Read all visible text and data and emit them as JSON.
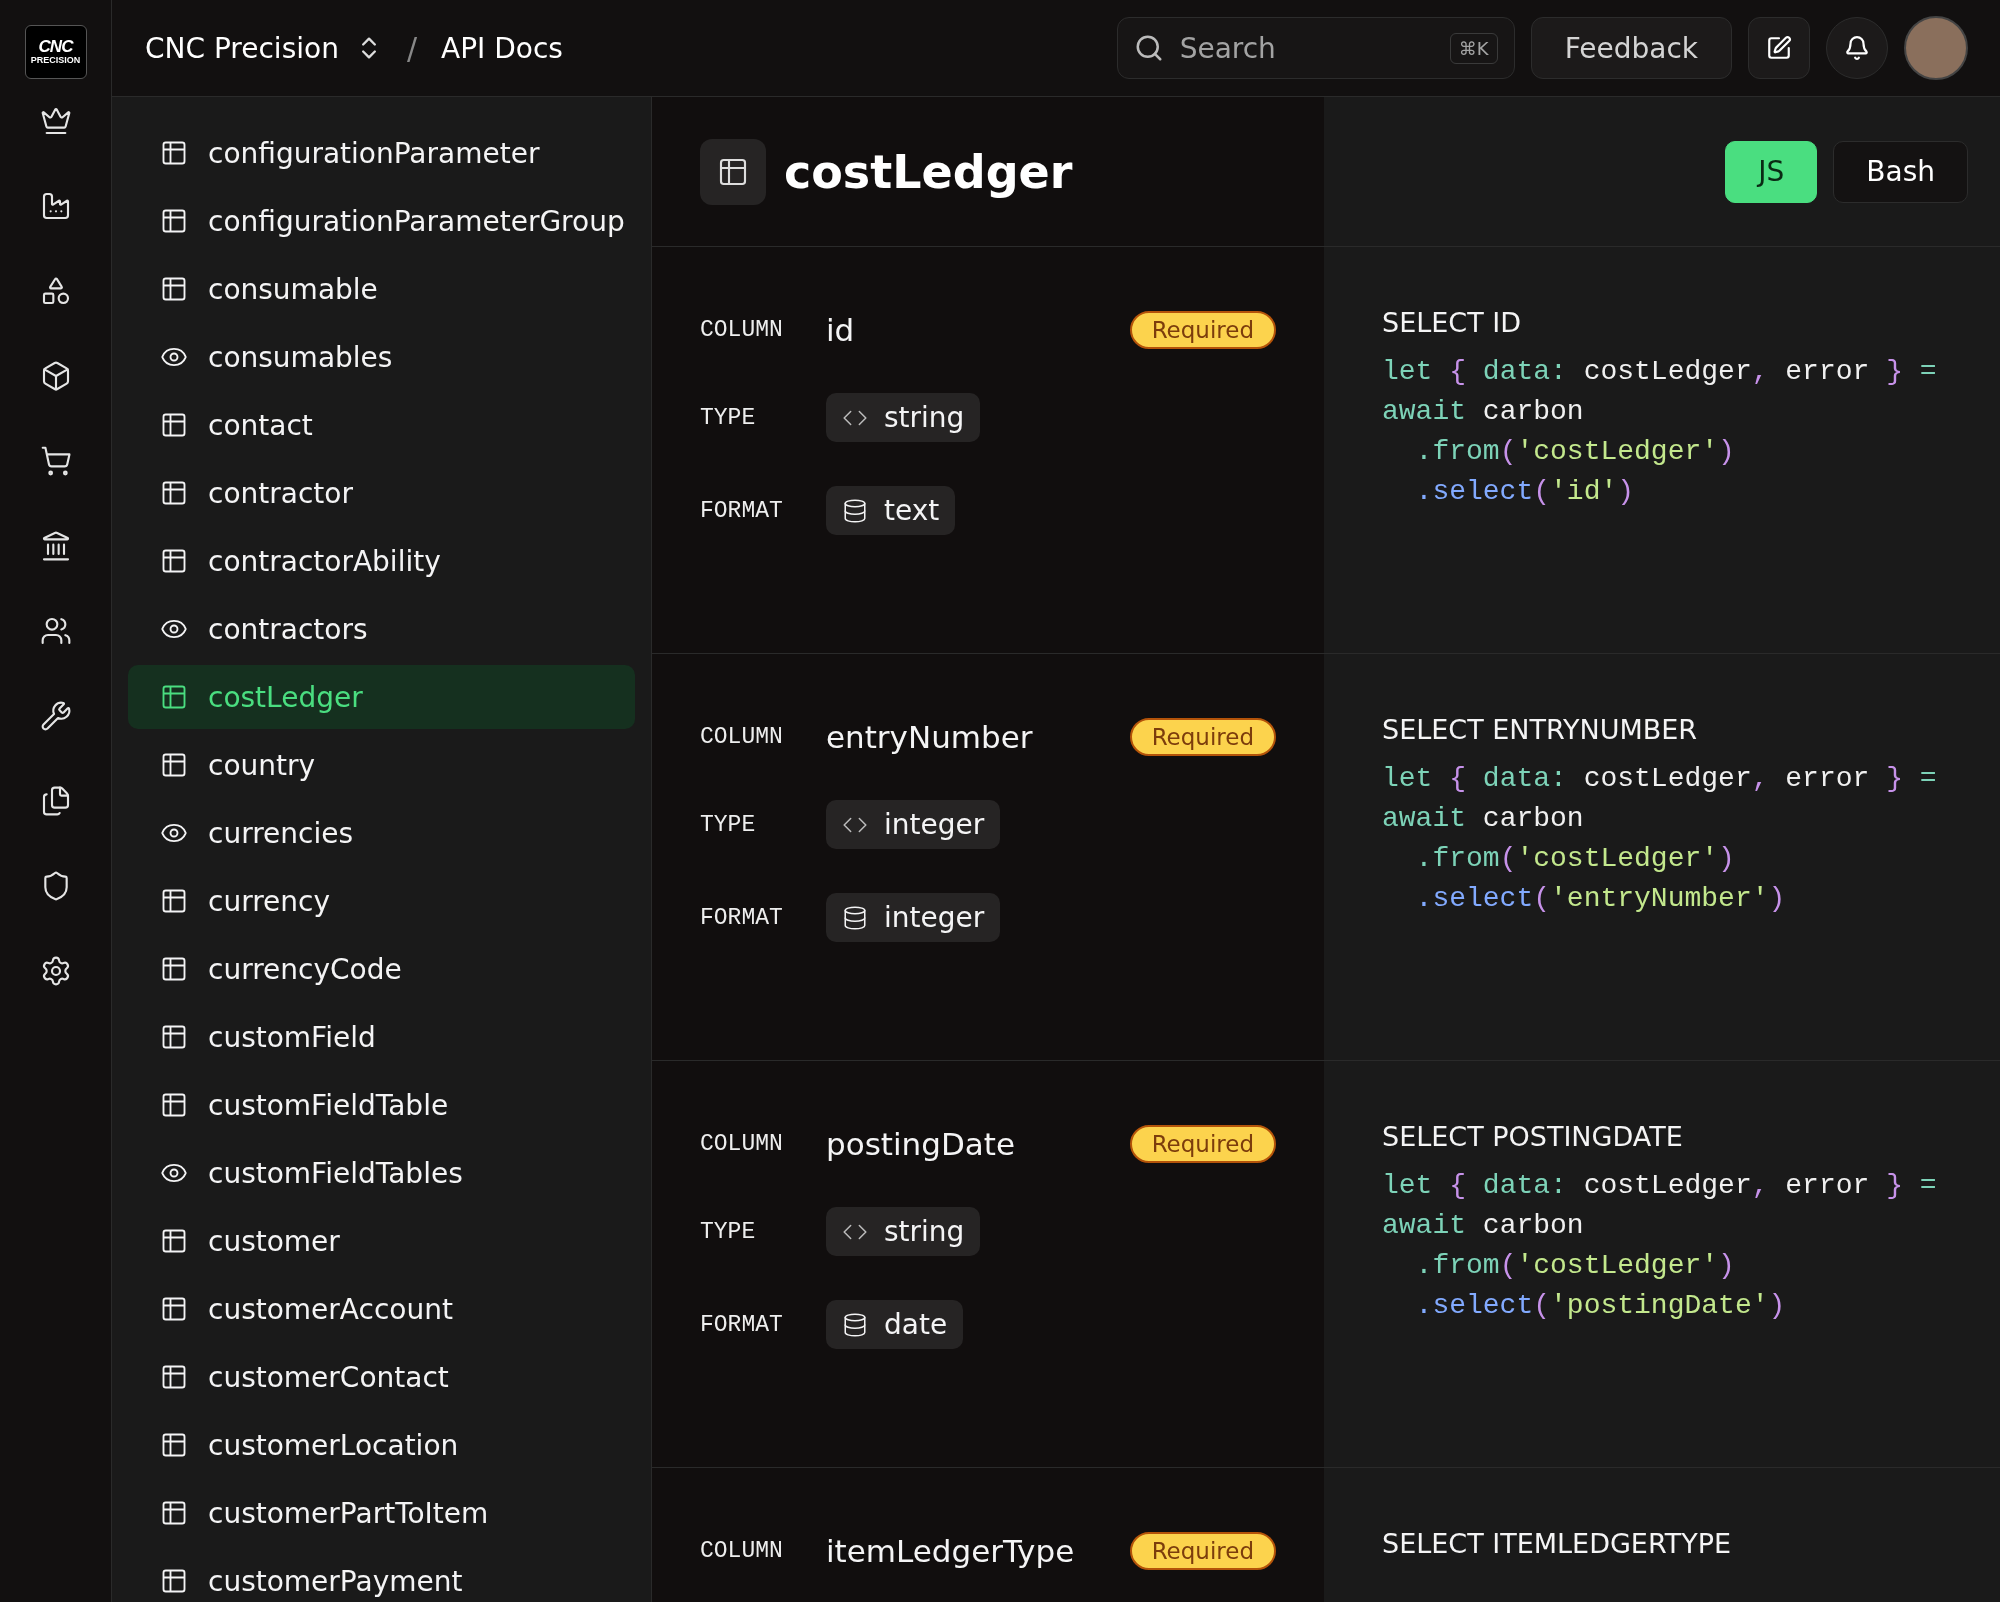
{
  "logo": {
    "line_1": "CNC",
    "line_2": "PRECISION"
  },
  "breadcrumb": {
    "workspace": "CNC Precision",
    "separator": "/",
    "page": "API Docs"
  },
  "search": {
    "placeholder": "Search",
    "shortcut": "⌘K"
  },
  "feedback_button": "Feedback",
  "sidebar": {
    "items": [
      {
        "label": "configurationParameter",
        "kind": "table",
        "selected": false
      },
      {
        "label": "configurationParameterGroup",
        "kind": "table",
        "selected": false
      },
      {
        "label": "consumable",
        "kind": "table",
        "selected": false
      },
      {
        "label": "consumables",
        "kind": "view",
        "selected": false
      },
      {
        "label": "contact",
        "kind": "table",
        "selected": false
      },
      {
        "label": "contractor",
        "kind": "table",
        "selected": false
      },
      {
        "label": "contractorAbility",
        "kind": "table",
        "selected": false
      },
      {
        "label": "contractors",
        "kind": "view",
        "selected": false
      },
      {
        "label": "costLedger",
        "kind": "table",
        "selected": true
      },
      {
        "label": "country",
        "kind": "table",
        "selected": false
      },
      {
        "label": "currencies",
        "kind": "view",
        "selected": false
      },
      {
        "label": "currency",
        "kind": "table",
        "selected": false
      },
      {
        "label": "currencyCode",
        "kind": "table",
        "selected": false
      },
      {
        "label": "customField",
        "kind": "table",
        "selected": false
      },
      {
        "label": "customFieldTable",
        "kind": "table",
        "selected": false
      },
      {
        "label": "customFieldTables",
        "kind": "view",
        "selected": false
      },
      {
        "label": "customer",
        "kind": "table",
        "selected": false
      },
      {
        "label": "customerAccount",
        "kind": "table",
        "selected": false
      },
      {
        "label": "customerContact",
        "kind": "table",
        "selected": false
      },
      {
        "label": "customerLocation",
        "kind": "table",
        "selected": false
      },
      {
        "label": "customerPartToItem",
        "kind": "table",
        "selected": false
      },
      {
        "label": "customerPayment",
        "kind": "table",
        "selected": false
      }
    ]
  },
  "title": "costLedger",
  "languages": [
    {
      "label": "JS",
      "selected": true
    },
    {
      "label": "Bash",
      "selected": false
    }
  ],
  "fields": [
    {
      "column_label": "COLUMN",
      "name": "id",
      "badge": "Required",
      "type_label": "TYPE",
      "type": "string",
      "format_label": "FORMAT",
      "format": "text",
      "heading": "SELECT ID",
      "code": [
        [
          {
            "t": "let ",
            "kind": "kw"
          },
          {
            "t": "{ ",
            "kind": "punct"
          },
          {
            "t": "data: ",
            "kind": "kw"
          },
          {
            "t": "costLedger",
            "kind": "plain"
          },
          {
            "t": ", ",
            "kind": "punct"
          },
          {
            "t": "error ",
            "kind": "plain"
          },
          {
            "t": "} ",
            "kind": "punct"
          },
          {
            "t": "=",
            "kind": "kw"
          }
        ],
        [
          {
            "t": "await ",
            "kind": "kw"
          },
          {
            "t": "carbon",
            "kind": "plain"
          }
        ],
        [
          {
            "t": "  .from",
            "kind": "kw"
          },
          {
            "t": "(",
            "kind": "punct"
          },
          {
            "t": "'costLedger'",
            "kind": "str"
          },
          {
            "t": ")",
            "kind": "punct"
          }
        ],
        [
          {
            "t": "  .select",
            "kind": "fn"
          },
          {
            "t": "(",
            "kind": "punct"
          },
          {
            "t": "'id'",
            "kind": "str"
          },
          {
            "t": ")",
            "kind": "punct"
          }
        ]
      ]
    },
    {
      "column_label": "COLUMN",
      "name": "entryNumber",
      "badge": "Required",
      "type_label": "TYPE",
      "type": "integer",
      "format_label": "FORMAT",
      "format": "integer",
      "heading": "SELECT ENTRYNUMBER",
      "code": [
        [
          {
            "t": "let ",
            "kind": "kw"
          },
          {
            "t": "{ ",
            "kind": "punct"
          },
          {
            "t": "data: ",
            "kind": "kw"
          },
          {
            "t": "costLedger",
            "kind": "plain"
          },
          {
            "t": ", ",
            "kind": "punct"
          },
          {
            "t": "error ",
            "kind": "plain"
          },
          {
            "t": "} ",
            "kind": "punct"
          },
          {
            "t": "=",
            "kind": "kw"
          }
        ],
        [
          {
            "t": "await ",
            "kind": "kw"
          },
          {
            "t": "carbon",
            "kind": "plain"
          }
        ],
        [
          {
            "t": "  .from",
            "kind": "kw"
          },
          {
            "t": "(",
            "kind": "punct"
          },
          {
            "t": "'costLedger'",
            "kind": "str"
          },
          {
            "t": ")",
            "kind": "punct"
          }
        ],
        [
          {
            "t": "  .select",
            "kind": "fn"
          },
          {
            "t": "(",
            "kind": "punct"
          },
          {
            "t": "'entryNumber'",
            "kind": "str"
          },
          {
            "t": ")",
            "kind": "punct"
          }
        ]
      ]
    },
    {
      "column_label": "COLUMN",
      "name": "postingDate",
      "badge": "Required",
      "type_label": "TYPE",
      "type": "string",
      "format_label": "FORMAT",
      "format": "date",
      "heading": "SELECT POSTINGDATE",
      "code": [
        [
          {
            "t": "let ",
            "kind": "kw"
          },
          {
            "t": "{ ",
            "kind": "punct"
          },
          {
            "t": "data: ",
            "kind": "kw"
          },
          {
            "t": "costLedger",
            "kind": "plain"
          },
          {
            "t": ", ",
            "kind": "punct"
          },
          {
            "t": "error ",
            "kind": "plain"
          },
          {
            "t": "} ",
            "kind": "punct"
          },
          {
            "t": "=",
            "kind": "kw"
          }
        ],
        [
          {
            "t": "await ",
            "kind": "kw"
          },
          {
            "t": "carbon",
            "kind": "plain"
          }
        ],
        [
          {
            "t": "  .from",
            "kind": "kw"
          },
          {
            "t": "(",
            "kind": "punct"
          },
          {
            "t": "'costLedger'",
            "kind": "str"
          },
          {
            "t": ")",
            "kind": "punct"
          }
        ],
        [
          {
            "t": "  .select",
            "kind": "fn"
          },
          {
            "t": "(",
            "kind": "punct"
          },
          {
            "t": "'postingDate'",
            "kind": "str"
          },
          {
            "t": ")",
            "kind": "punct"
          }
        ]
      ]
    },
    {
      "column_label": "COLUMN",
      "name": "itemLedgerType",
      "badge": "Required",
      "heading": "SELECT ITEMLEDGERTYPE"
    }
  ]
}
